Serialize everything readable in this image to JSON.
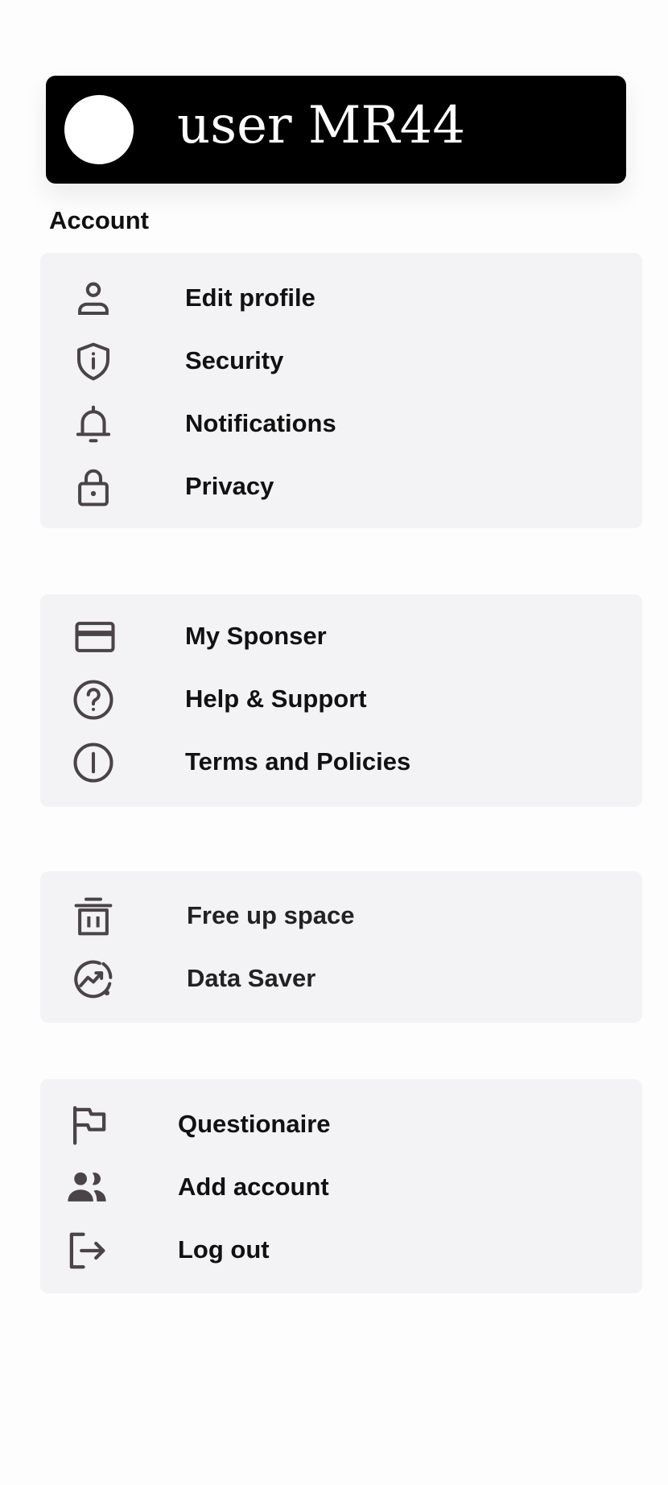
{
  "profile": {
    "username": "user MR44"
  },
  "account": {
    "title": "Account",
    "items": [
      {
        "label": "Edit profile",
        "icon": "user-icon"
      },
      {
        "label": "Security",
        "icon": "shield-icon"
      },
      {
        "label": "Notifications",
        "icon": "bell-icon"
      },
      {
        "label": "Privacy",
        "icon": "lock-icon"
      }
    ]
  },
  "support": {
    "items": [
      {
        "label": "My Sponser",
        "icon": "credit-card-icon"
      },
      {
        "label": "Help & Support",
        "icon": "help-circle-icon"
      },
      {
        "label": "Terms and Policies",
        "icon": "info-circle-icon"
      }
    ]
  },
  "storage": {
    "items": [
      {
        "label": "Free up space",
        "icon": "trash-icon"
      },
      {
        "label": "Data Saver",
        "icon": "data-saver-icon"
      }
    ]
  },
  "actions": {
    "items": [
      {
        "label": "Questionaire",
        "icon": "flag-icon"
      },
      {
        "label": "Add account",
        "icon": "users-icon"
      },
      {
        "label": "Log out",
        "icon": "logout-icon"
      }
    ]
  },
  "colors": {
    "header_bg": "#000000",
    "group_bg": "#f3f3f5",
    "icon": "#4a4446"
  }
}
